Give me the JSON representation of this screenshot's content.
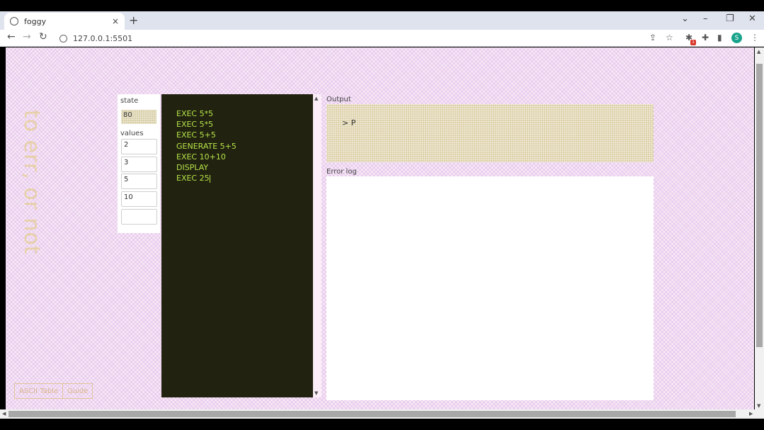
{
  "browser": {
    "tab_title": "foggy",
    "tab_close": "×",
    "new_tab": "+",
    "url": "127.0.0.1:5501",
    "window_controls": [
      "⌄",
      "–",
      "❐",
      "✕"
    ],
    "nav": {
      "back": "←",
      "forward": "→",
      "reload": "↻"
    },
    "toolbar_icons": {
      "share": "⇪",
      "star": "☆",
      "puzzle": "✚",
      "sidebar": "▮",
      "menu": "⋮"
    },
    "extension_badge": "1",
    "profile_initial": "S"
  },
  "app": {
    "motto": "to err, or not",
    "buttons": {
      "ascii_table": "ASCII Table",
      "guide": "Guide"
    },
    "state": {
      "label": "state",
      "value": "80"
    },
    "values": {
      "label": "values",
      "items": [
        "2",
        "3",
        "5",
        "10",
        ""
      ]
    },
    "editor": {
      "lines": [
        "EXEC 5*5",
        "EXEC 5*5",
        "EXEC 5+5",
        "GENERATE 5+5",
        "EXEC 10+10",
        "DISPLAY",
        "EXEC 25"
      ]
    },
    "output": {
      "label": "Output",
      "text": "> P"
    },
    "error_log": {
      "label": "Error log",
      "text": ""
    }
  },
  "colors": {
    "editor_bg": "#21220f",
    "editor_text": "#b5e24a",
    "accent_tan": "#ddd0a8",
    "motto": "#e7d0a8"
  }
}
